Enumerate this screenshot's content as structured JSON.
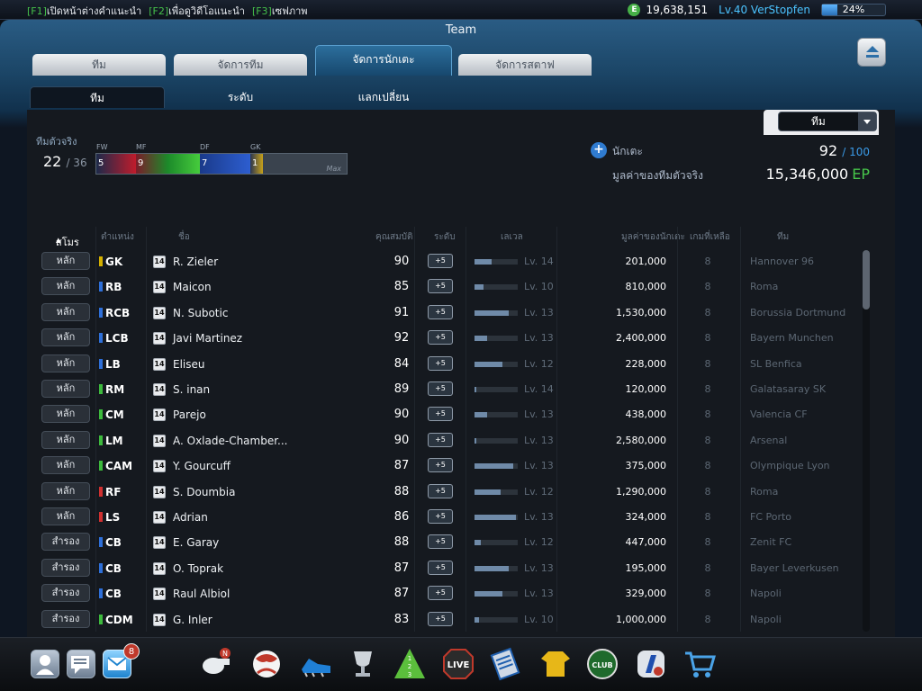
{
  "topbar": {
    "hotkeys": [
      {
        "key": "[F1]",
        "label": "เปิดหน้าต่างคำแนะนำ"
      },
      {
        "key": "[F2]",
        "label": "เพื่อดูวิดีโอแนะนำ"
      },
      {
        "key": "[F3]",
        "label": "เซฟภาพ"
      }
    ],
    "currency_icon": "E",
    "money": "19,638,151",
    "level_user": "Lv.40 VerStopfen",
    "xp_percent": "24%",
    "xp_fraction": 0.24
  },
  "panel": {
    "title": "Team",
    "tabs": [
      "ทีม",
      "จัดการทีม",
      "จัดการนักเตะ",
      "จัดการสตาฟ"
    ],
    "active_tab": 2,
    "subtabs": [
      "ทีม",
      "ระดับ",
      "แลกเปลี่ยน"
    ],
    "active_subtab": 0
  },
  "filter": {
    "selected": "ทีม"
  },
  "realteam": {
    "label": "ทีมตัวจริง",
    "current": "22",
    "max": "/ 36",
    "positions": [
      {
        "label": "FW",
        "count": "5"
      },
      {
        "label": "MF",
        "count": "9"
      },
      {
        "label": "DF",
        "count": "7"
      },
      {
        "label": "GK",
        "count": "1"
      }
    ],
    "max_label": "Max"
  },
  "summary": {
    "players_label": "นักเตะ",
    "players_current": "92",
    "players_max": "/ 100",
    "value_label": "มูลค่าของทีมตัวจริง",
    "value_amount": "15,346,000",
    "value_unit": "EP"
  },
  "table": {
    "headers": {
      "club": "สโมร",
      "position": "ตำแหน่ง",
      "name": "ชื่อ",
      "ovr": "คุณสมบัติ",
      "grade": "ระดับ",
      "level": "เลเวล",
      "value": "มูลค่าของนักเตะ",
      "games": "เกมที่เหลือ",
      "team": "ทีม"
    },
    "rows": [
      {
        "role": "หลัก",
        "pos": "GK",
        "color": "#d4b000",
        "badge": "14",
        "name": "R. Zieler",
        "ovr": "90",
        "grade": "+5",
        "lv": "Lv. 14",
        "lv_frac": 0.4,
        "value": "201,000",
        "games": "8",
        "team": "Hannover 96"
      },
      {
        "role": "หลัก",
        "pos": "RB",
        "color": "#2e6fd8",
        "badge": "14",
        "name": "Maicon",
        "ovr": "85",
        "grade": "+5",
        "lv": "Lv. 10",
        "lv_frac": 0.2,
        "value": "810,000",
        "games": "8",
        "team": "Roma"
      },
      {
        "role": "หลัก",
        "pos": "RCB",
        "color": "#2e6fd8",
        "badge": "14",
        "name": "N. Subotic",
        "ovr": "91",
        "grade": "+5",
        "lv": "Lv. 13",
        "lv_frac": 0.8,
        "value": "1,530,000",
        "games": "8",
        "team": "Borussia Dortmund"
      },
      {
        "role": "หลัก",
        "pos": "LCB",
        "color": "#2e6fd8",
        "badge": "14",
        "name": "Javi Martinez",
        "ovr": "92",
        "grade": "+5",
        "lv": "Lv. 13",
        "lv_frac": 0.3,
        "value": "2,400,000",
        "games": "8",
        "team": "Bayern Munchen"
      },
      {
        "role": "หลัก",
        "pos": "LB",
        "color": "#2e6fd8",
        "badge": "14",
        "name": "Eliseu",
        "ovr": "84",
        "grade": "+5",
        "lv": "Lv. 12",
        "lv_frac": 0.65,
        "value": "228,000",
        "games": "8",
        "team": "SL Benfica"
      },
      {
        "role": "หลัก",
        "pos": "RM",
        "color": "#3dba3d",
        "badge": "14",
        "name": "S. inan",
        "ovr": "89",
        "grade": "+5",
        "lv": "Lv. 14",
        "lv_frac": 0.05,
        "value": "120,000",
        "games": "8",
        "team": "Galatasaray SK"
      },
      {
        "role": "หลัก",
        "pos": "CM",
        "color": "#3dba3d",
        "badge": "14",
        "name": "Parejo",
        "ovr": "90",
        "grade": "+5",
        "lv": "Lv. 13",
        "lv_frac": 0.3,
        "value": "438,000",
        "games": "8",
        "team": "Valencia CF"
      },
      {
        "role": "หลัก",
        "pos": "LM",
        "color": "#3dba3d",
        "badge": "14",
        "name": "A. Oxlade-Chamber...",
        "ovr": "90",
        "grade": "+5",
        "lv": "Lv. 13",
        "lv_frac": 0.05,
        "value": "2,580,000",
        "games": "8",
        "team": "Arsenal"
      },
      {
        "role": "หลัก",
        "pos": "CAM",
        "color": "#3dba3d",
        "badge": "14",
        "name": "Y. Gourcuff",
        "ovr": "87",
        "grade": "+5",
        "lv": "Lv. 13",
        "lv_frac": 0.9,
        "value": "375,000",
        "games": "8",
        "team": "Olympique Lyon"
      },
      {
        "role": "หลัก",
        "pos": "RF",
        "color": "#d03030",
        "badge": "14",
        "name": "S. Doumbia",
        "ovr": "88",
        "grade": "+5",
        "lv": "Lv. 12",
        "lv_frac": 0.6,
        "value": "1,290,000",
        "games": "8",
        "team": "Roma"
      },
      {
        "role": "หลัก",
        "pos": "LS",
        "color": "#d03030",
        "badge": "14",
        "name": "Adrian",
        "ovr": "86",
        "grade": "+5",
        "lv": "Lv. 13",
        "lv_frac": 0.95,
        "value": "324,000",
        "games": "8",
        "team": "FC Porto"
      },
      {
        "role": "สำรอง",
        "pos": "CB",
        "color": "#2e6fd8",
        "badge": "14",
        "name": "E. Garay",
        "ovr": "88",
        "grade": "+5",
        "lv": "Lv. 12",
        "lv_frac": 0.15,
        "value": "447,000",
        "games": "8",
        "team": "Zenit FC"
      },
      {
        "role": "สำรอง",
        "pos": "CB",
        "color": "#2e6fd8",
        "badge": "14",
        "name": "O. Toprak",
        "ovr": "87",
        "grade": "+5",
        "lv": "Lv. 13",
        "lv_frac": 0.8,
        "value": "195,000",
        "games": "8",
        "team": "Bayer Leverkusen"
      },
      {
        "role": "สำรอง",
        "pos": "CB",
        "color": "#2e6fd8",
        "badge": "14",
        "name": "Raul Albiol",
        "ovr": "87",
        "grade": "+5",
        "lv": "Lv. 13",
        "lv_frac": 0.65,
        "value": "329,000",
        "games": "8",
        "team": "Napoli"
      },
      {
        "role": "สำรอง",
        "pos": "CDM",
        "color": "#3dba3d",
        "badge": "14",
        "name": "G. Inler",
        "ovr": "83",
        "grade": "+5",
        "lv": "Lv. 10",
        "lv_frac": 0.1,
        "value": "1,000,000",
        "games": "8",
        "team": "Napoli"
      }
    ]
  },
  "bottombar": {
    "left_buttons": [
      "profile-icon",
      "chat-icon",
      "mail-icon"
    ],
    "mail_badge": "8",
    "icons": [
      "whistle-icon",
      "ball-icon",
      "boots-icon",
      "trophy-icon",
      "ranking-icon",
      "live-icon",
      "clipboard-icon",
      "jersey-icon",
      "club-icon",
      "transfer-icon",
      "shop-cart-icon"
    ],
    "whistle_badge": "N",
    "live_label": "LIVE",
    "club_label": "CLUB",
    "rank_numbers": [
      "1",
      "2",
      "3"
    ]
  }
}
